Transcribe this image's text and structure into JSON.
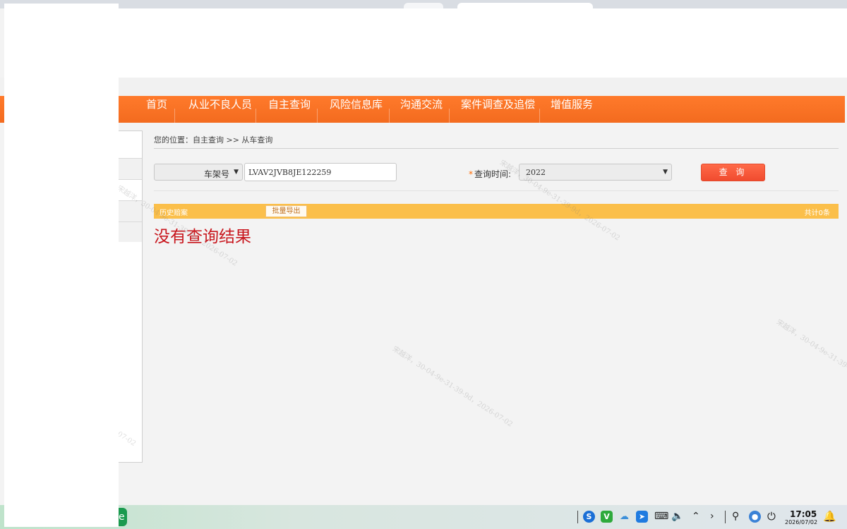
{
  "nav": {
    "items": [
      "首页",
      "从业不良人员",
      "自主查询",
      "风险信息库",
      "沟通交流",
      "案件调查及追偿",
      "增值服务"
    ]
  },
  "breadcrumb": "您的位置：自主查询 >> 从车查询",
  "search": {
    "type_value": "车架号",
    "vin_value": "LVAV2JVB8JE122259",
    "time_required_mark": "*",
    "time_label": "查询时间:",
    "year_value": "2022",
    "query_button": "查 询"
  },
  "results": {
    "title": "历史赔案",
    "export_button": "批量导出",
    "count": "共计0条",
    "empty_message": "没有查询结果"
  },
  "watermark": {
    "text": "宋越洋，30-04-9e-31-39-9d，2026-07-02",
    "fragment": "07-02"
  },
  "taskbar": {
    "time": "17:05",
    "date": "2026/07/02",
    "tray_s": "S",
    "tray_v": "V"
  },
  "colors": {
    "nav_orange": "#f36b1f",
    "result_bar": "#fbbf4a",
    "query_button": "#f04b2f",
    "empty_text": "#c8161d"
  }
}
